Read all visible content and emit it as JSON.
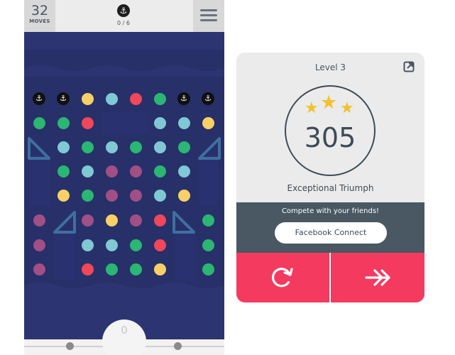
{
  "game": {
    "moves_count": "32",
    "moves_label": "MOVES",
    "goal_progress": "0 / 6",
    "goal_icon": "anchor-icon",
    "score": "0",
    "menu_icon": "hamburger-menu-icon",
    "colors": {
      "green": "#2bb673",
      "teal": "#7fc8d4",
      "red": "#f0475a",
      "yellow": "#f8d066",
      "purple": "#a14f86",
      "board": "#2d3472"
    },
    "grid": [
      [
        "anchor",
        "anchor",
        "yellow",
        "teal",
        "red",
        "green",
        "anchor",
        "anchor"
      ],
      [
        "green",
        "green",
        "red",
        "",
        "",
        "teal",
        "teal",
        "yellow"
      ],
      [
        "",
        "teal",
        "green",
        "teal",
        "green",
        "teal",
        "green",
        ""
      ],
      [
        "",
        "green",
        "teal",
        "purple",
        "purple",
        "green",
        "teal",
        ""
      ],
      [
        "",
        "yellow",
        "green",
        "purple",
        "purple",
        "teal",
        "yellow",
        ""
      ],
      [
        "purple",
        "",
        "purple",
        "yellow",
        "purple",
        "red",
        "",
        "green"
      ],
      [
        "purple",
        "",
        "teal",
        "teal",
        "green",
        "red",
        "",
        "green"
      ],
      [
        "purple",
        "",
        "red",
        "green",
        "green",
        "yellow",
        "",
        "green"
      ]
    ]
  },
  "card": {
    "level_title": "Level 3",
    "share_icon": "external-link-icon",
    "stars": 3,
    "score": "305",
    "result_label": "Exceptional Triumph",
    "compete_text": "Compete with your friends!",
    "facebook_button": "Facebook Connect",
    "retry_icon": "replay-icon",
    "next_icon": "double-arrow-right-icon"
  }
}
